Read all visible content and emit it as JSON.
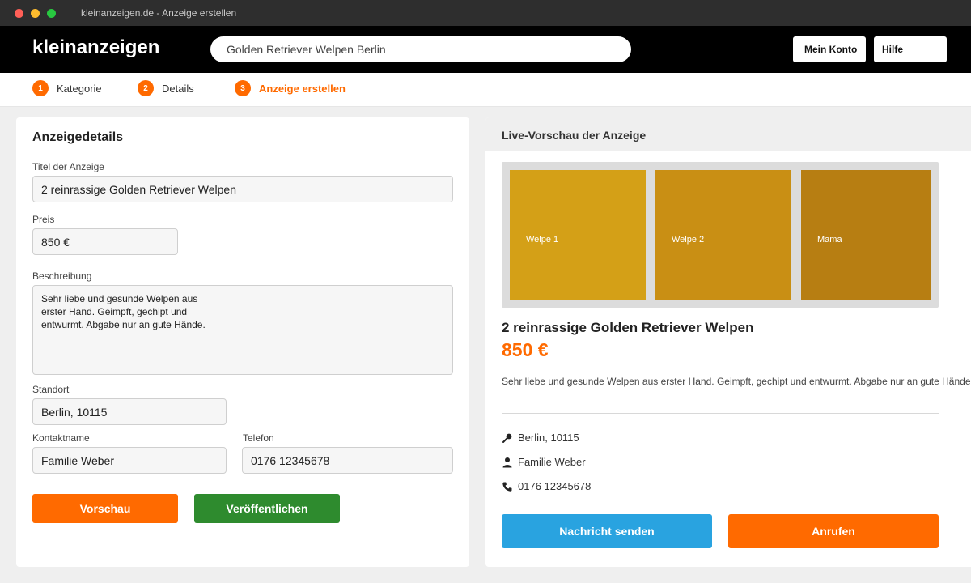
{
  "window": {
    "title": "kleinanzeigen.de - Anzeige erstellen"
  },
  "header": {
    "logo": "kleinanzeigen",
    "search_value": "Golden Retriever Welpen Berlin",
    "account_label": "Mein Konto",
    "help_label": "Hilfe"
  },
  "steps": [
    {
      "num": "1",
      "label": "Kategorie"
    },
    {
      "num": "2",
      "label": "Details"
    },
    {
      "num": "3",
      "label": "Anzeige erstellen"
    }
  ],
  "form": {
    "section_title": "Anzeigedetails",
    "title_label": "Titel der Anzeige",
    "title_value": "2 reinrassige Golden Retriever Welpen",
    "price_label": "Preis",
    "price_value": "850 €",
    "description_label": "Beschreibung",
    "description_value": "Sehr liebe und gesunde Welpen aus\nerster Hand. Geimpft, gechipt und\nentwurmt. Abgabe nur an gute Hände.",
    "location_label": "Standort",
    "location_value": "Berlin, 10115",
    "contact_label": "Kontaktname",
    "contact_value": "Familie Weber",
    "phone_label": "Telefon",
    "phone_value": "0176 12345678",
    "preview_button": "Vorschau",
    "publish_button": "Veröffentlichen"
  },
  "preview": {
    "header": "Live-Vorschau der Anzeige",
    "photos": [
      {
        "label": "Welpe 1",
        "color": "#d4a017"
      },
      {
        "label": "Welpe 2",
        "color": "#c98f14"
      },
      {
        "label": "Mama",
        "color": "#b77e12"
      }
    ],
    "title": "2 reinrassige Golden Retriever Welpen",
    "price": "850 €",
    "description": "Sehr liebe und gesunde Welpen aus erster Hand. Geimpft, gechipt und entwurmt. Abgabe nur an gute Hände.",
    "location": "Berlin, 10115",
    "contact": "Familie Weber",
    "phone": "0176 12345678",
    "message_button": "Nachricht senden",
    "call_button": "Anrufen"
  },
  "colors": {
    "accent_orange": "#ff6a00",
    "publish_green": "#2e8b2e",
    "message_blue": "#29a3e0"
  }
}
